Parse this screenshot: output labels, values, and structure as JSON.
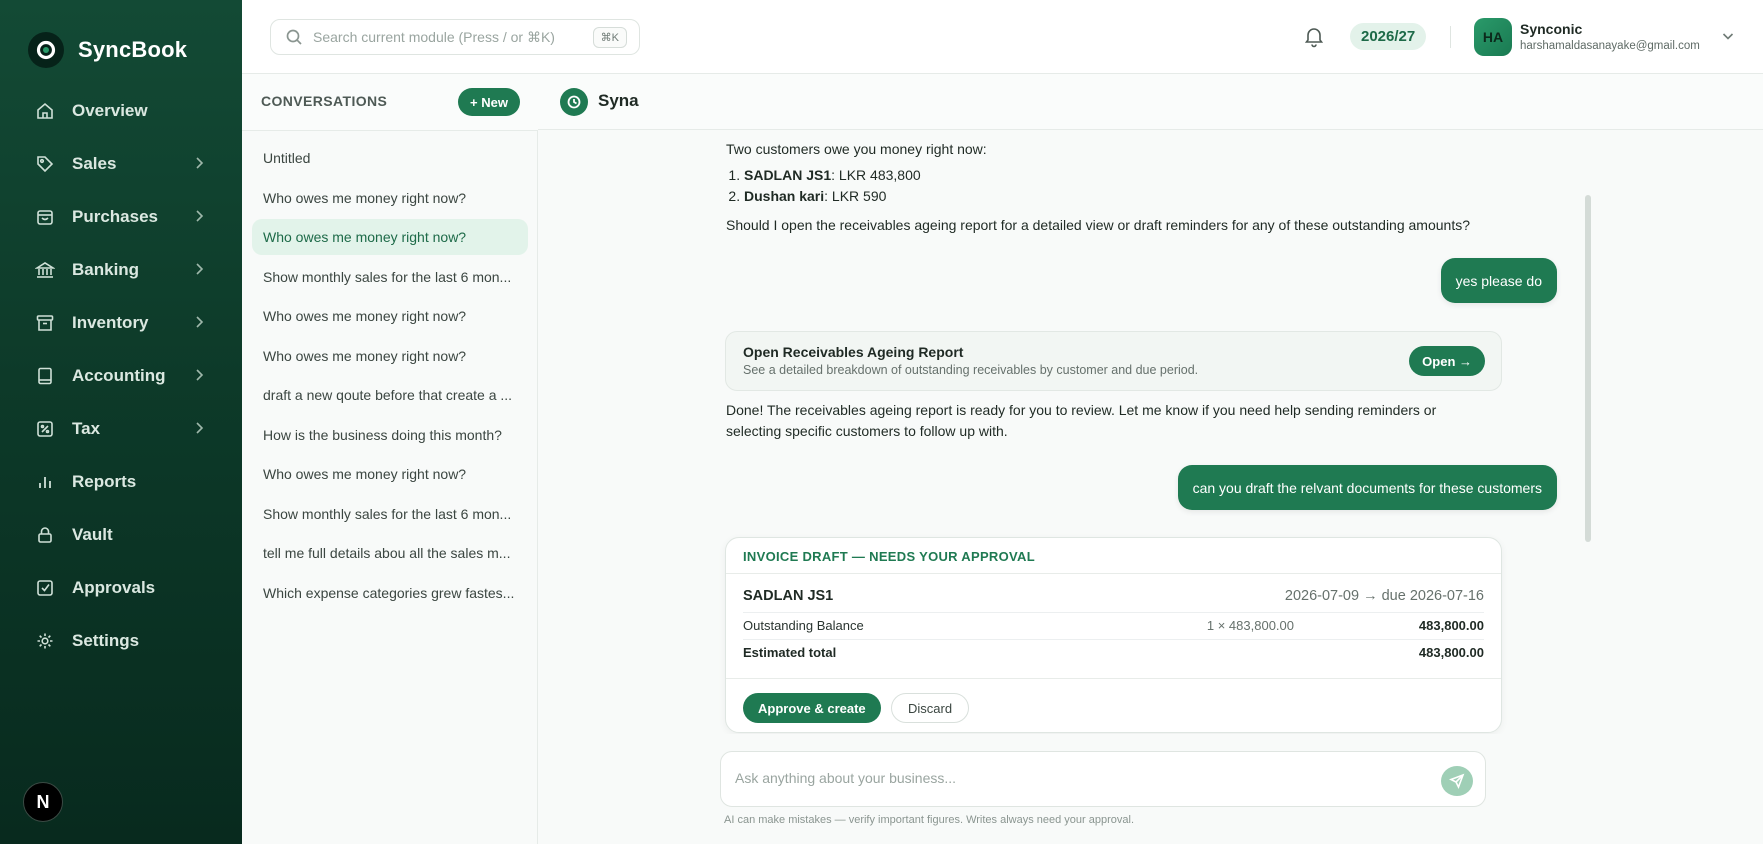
{
  "app": {
    "name": "SyncBook"
  },
  "sidebar": {
    "items": [
      {
        "label": "Overview",
        "icon": "home-icon",
        "has_children": false
      },
      {
        "label": "Sales",
        "icon": "tag-icon",
        "has_children": true
      },
      {
        "label": "Purchases",
        "icon": "bag-icon",
        "has_children": true
      },
      {
        "label": "Banking",
        "icon": "bank-icon",
        "has_children": true
      },
      {
        "label": "Inventory",
        "icon": "archive-icon",
        "has_children": true
      },
      {
        "label": "Accounting",
        "icon": "book-icon",
        "has_children": true
      },
      {
        "label": "Tax",
        "icon": "percent-icon",
        "has_children": true
      },
      {
        "label": "Reports",
        "icon": "bar-chart-icon",
        "has_children": false
      },
      {
        "label": "Vault",
        "icon": "lock-icon",
        "has_children": false
      },
      {
        "label": "Approvals",
        "icon": "checkbox-icon",
        "has_children": false
      },
      {
        "label": "Settings",
        "icon": "gear-icon",
        "has_children": false
      }
    ],
    "footer_badge": "N"
  },
  "topbar": {
    "search_placeholder": "Search current module (Press / or ⌘K)",
    "search_shortcut": "⌘K",
    "fiscal_year": "2026/27",
    "user": {
      "initials": "HA",
      "name": "Synconic",
      "email": "harshamaldasanayake@gmail.com"
    }
  },
  "conversations": {
    "title": "CONVERSATIONS",
    "new_label": "+ New",
    "items": [
      {
        "label": "Untitled",
        "active": false
      },
      {
        "label": "Who owes me money right now?",
        "active": false
      },
      {
        "label": "Who owes me money right now?",
        "active": true
      },
      {
        "label": "Show monthly sales for the last 6 mon...",
        "active": false
      },
      {
        "label": "Who owes me money right now?",
        "active": false
      },
      {
        "label": "Who owes me money right now?",
        "active": false
      },
      {
        "label": "draft a new qoute before that create a ...",
        "active": false
      },
      {
        "label": "How is the business doing this month?",
        "active": false
      },
      {
        "label": "Who owes me money right now?",
        "active": false
      },
      {
        "label": "Show monthly sales for the last 6 mon...",
        "active": false
      },
      {
        "label": "tell me full details abou all the sales m...",
        "active": false
      },
      {
        "label": "Which expense categories grew fastes...",
        "active": false
      }
    ]
  },
  "chat": {
    "assistant_name": "Syna",
    "msg1": {
      "intro": "Two customers owe you money right now:",
      "debtors": [
        {
          "name": "SADLAN JS1",
          "amount": ": LKR 483,800"
        },
        {
          "name": "Dushan kari",
          "amount": ": LKR 590"
        }
      ],
      "question": "Should I open the receivables ageing report for a detailed view or draft reminders for any of these outstanding amounts?"
    },
    "user_msg1": "yes please do",
    "action_card": {
      "title": "Open Receivables Ageing Report",
      "subtitle": "See a detailed breakdown of outstanding receivables by customer and due period.",
      "button": "Open →"
    },
    "msg2": {
      "line1": "Done! The receivables ageing report is ready for you to review. Let me know if you need help sending reminders or",
      "line2": "selecting specific customers to follow up with."
    },
    "user_msg2": "can you draft the relvant documents for these customers",
    "invoice": {
      "header": "INVOICE DRAFT — NEEDS YOUR APPROVAL",
      "customer": "SADLAN JS1",
      "dates": "2026-07-09 → due 2026-07-16",
      "line": {
        "desc": "Outstanding Balance",
        "qty": "1 × 483,800.00",
        "amount": "483,800.00"
      },
      "total": {
        "label": "Estimated total",
        "amount": "483,800.00"
      },
      "approve_label": "Approve & create",
      "discard_label": "Discard"
    },
    "composer_placeholder": "Ask anything about your business...",
    "disclaimer": "AI can make mistakes — verify important figures. Writes always need your approval."
  },
  "colors": {
    "brand": "#1f7a52",
    "sidebar_bg": "#0d3a29",
    "active_bg": "#e2f3ea"
  }
}
